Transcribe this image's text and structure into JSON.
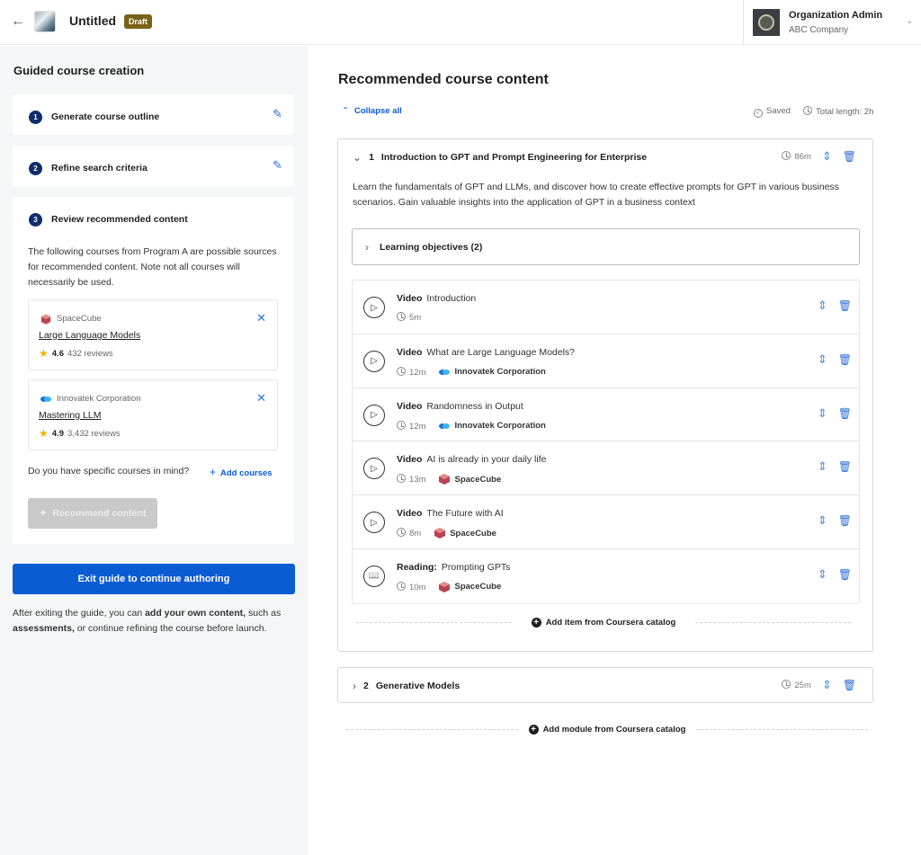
{
  "header": {
    "back_icon": "arrow-left-icon",
    "course_title": "Untitled",
    "status_badge": "Draft",
    "org": {
      "name": "Organization Admin",
      "company": "ABC Company"
    }
  },
  "sidebar": {
    "title": "Guided course creation",
    "steps": [
      {
        "num": "1",
        "label": "Generate course outline"
      },
      {
        "num": "2",
        "label": "Refine search criteria"
      },
      {
        "num": "3",
        "label": "Review recommended content"
      }
    ],
    "review_desc": "The following courses from Program A are possible sources for recommended content. Note not all courses will necessarily be used.",
    "courses": [
      {
        "provider": "SpaceCube",
        "title": "Large Language Models",
        "rating": "4.6",
        "reviews": "432 reviews"
      },
      {
        "provider": "Innovatek Corporation",
        "title": "Mastering LLM",
        "rating": "4.9",
        "reviews": "3,432 reviews"
      }
    ],
    "ask_text": "Do you have specific courses in mind?",
    "add_courses_label": "Add courses",
    "recommend_label": "Recommend content",
    "exit_label": "Exit guide to continue authoring",
    "after_pre": "After exiting the guide, you can ",
    "after_bold1": "add your own content,",
    "after_mid": " such as ",
    "after_bold2": "assessments,",
    "after_post": " or continue refining the course before launch."
  },
  "main": {
    "title": "Recommended course content",
    "collapse_label": "Collapse all",
    "saved_label": "Saved",
    "total_length": "Total length: 2h",
    "modules": [
      {
        "num": "1",
        "title": "Introduction to GPT and Prompt Engineering for Enterprise",
        "duration": "86m",
        "description": "Learn the fundamentals of GPT and LLMs, and discover how to create effective prompts for GPT in various business scenarios. Gain valuable insights into the application of GPT in a business context",
        "objectives_label": "Learning objectives (2)",
        "items": [
          {
            "type": "Video",
            "title": "Introduction",
            "duration": "5m",
            "provider": ""
          },
          {
            "type": "Video",
            "title": "What are Large Language Models?",
            "duration": "12m",
            "provider": "Innovatek Corporation"
          },
          {
            "type": "Video",
            "title": "Randomness in Output",
            "duration": "12m",
            "provider": "Innovatek Corporation"
          },
          {
            "type": "Video",
            "title": "AI is already in your daily life",
            "duration": "13m",
            "provider": "SpaceCube"
          },
          {
            "type": "Video",
            "title": "The Future with AI",
            "duration": "8m",
            "provider": "SpaceCube"
          },
          {
            "type": "Reading:",
            "title": "Prompting GPTs",
            "duration": "10m",
            "provider": "SpaceCube"
          }
        ],
        "add_item_label": "Add item from Coursera catalog"
      },
      {
        "num": "2",
        "title": "Generative Models",
        "duration": "25m"
      }
    ],
    "add_module_label": "Add module from Coursera catalog"
  },
  "colors": {
    "primary": "#0b5bd3",
    "step_badge": "#0f2d6b",
    "draft_badge": "#7a6318",
    "disabled": "#c9c9c9"
  }
}
